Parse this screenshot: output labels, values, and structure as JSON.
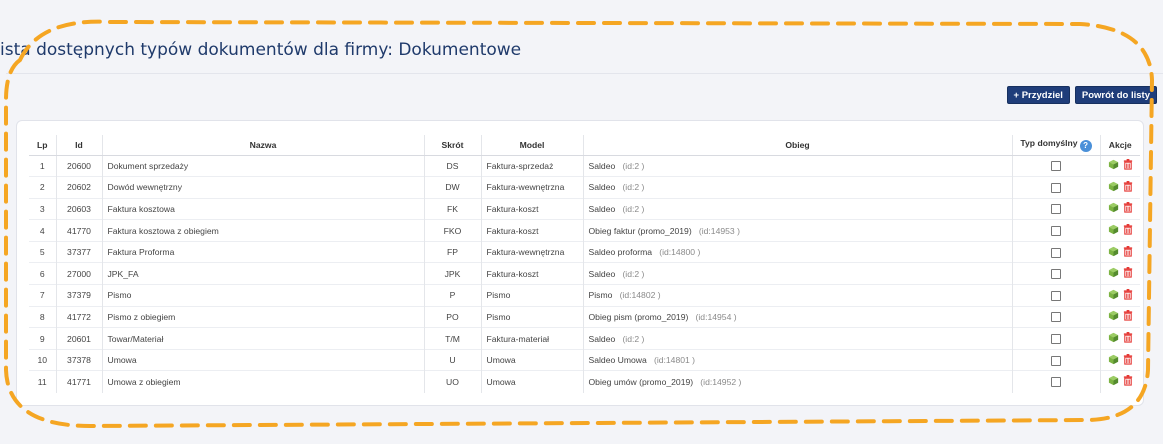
{
  "page": {
    "title": "ista dostępnych typów dokumentów dla firmy: Dokumentowe"
  },
  "toolbar": {
    "assign_label": "+ Przydziel",
    "back_label": "Powrót do listy"
  },
  "table": {
    "headers": {
      "lp": "Lp",
      "id": "Id",
      "nazwa": "Nazwa",
      "skrot": "Skrót",
      "model": "Model",
      "obieg": "Obieg",
      "typ": "Typ domyślny",
      "akcje": "Akcje"
    },
    "rows": [
      {
        "lp": "1",
        "id": "20600",
        "nazwa": "Dokument sprzedaży",
        "skrot": "DS",
        "model": "Faktura-sprzedaż",
        "obieg": "Saldeo",
        "obieg_id": "(id:2 )",
        "checked": false
      },
      {
        "lp": "2",
        "id": "20602",
        "nazwa": "Dowód wewnętrzny",
        "skrot": "DW",
        "model": "Faktura-wewnętrzna",
        "obieg": "Saldeo",
        "obieg_id": "(id:2 )",
        "checked": false
      },
      {
        "lp": "3",
        "id": "20603",
        "nazwa": "Faktura kosztowa",
        "skrot": "FK",
        "model": "Faktura-koszt",
        "obieg": "Saldeo",
        "obieg_id": "(id:2 )",
        "checked": false
      },
      {
        "lp": "4",
        "id": "41770",
        "nazwa": "Faktura kosztowa z obiegiem",
        "skrot": "FKO",
        "model": "Faktura-koszt",
        "obieg": "Obieg faktur (promo_2019)",
        "obieg_id": "(id:14953 )",
        "checked": false
      },
      {
        "lp": "5",
        "id": "37377",
        "nazwa": "Faktura Proforma",
        "skrot": "FP",
        "model": "Faktura-wewnętrzna",
        "obieg": "Saldeo proforma",
        "obieg_id": "(id:14800 )",
        "checked": false
      },
      {
        "lp": "6",
        "id": "27000",
        "nazwa": "JPK_FA",
        "skrot": "JPK",
        "model": "Faktura-koszt",
        "obieg": "Saldeo",
        "obieg_id": "(id:2 )",
        "checked": false
      },
      {
        "lp": "7",
        "id": "37379",
        "nazwa": "Pismo",
        "skrot": "P",
        "model": "Pismo",
        "obieg": "Pismo",
        "obieg_id": "(id:14802 )",
        "checked": false
      },
      {
        "lp": "8",
        "id": "41772",
        "nazwa": "Pismo z obiegiem",
        "skrot": "PO",
        "model": "Pismo",
        "obieg": "Obieg pism (promo_2019)",
        "obieg_id": "(id:14954 )",
        "checked": false
      },
      {
        "lp": "9",
        "id": "20601",
        "nazwa": "Towar/Materiał",
        "skrot": "T/M",
        "model": "Faktura-materiał",
        "obieg": "Saldeo",
        "obieg_id": "(id:2 )",
        "checked": false
      },
      {
        "lp": "10",
        "id": "37378",
        "nazwa": "Umowa",
        "skrot": "U",
        "model": "Umowa",
        "obieg": "Saldeo Umowa",
        "obieg_id": "(id:14801 )",
        "checked": false
      },
      {
        "lp": "11",
        "id": "41771",
        "nazwa": "Umowa z obiegiem",
        "skrot": "UO",
        "model": "Umowa",
        "obieg": "Obieg umów (promo_2019)",
        "obieg_id": "(id:14952 )",
        "checked": false
      }
    ]
  },
  "icons": {
    "help": "help-icon",
    "edit": "cube-icon",
    "delete": "trash-icon"
  },
  "colors": {
    "accent": "#1f3d7a",
    "highlight": "#f5a623",
    "edit": "#7cb342",
    "delete": "#e53935"
  }
}
